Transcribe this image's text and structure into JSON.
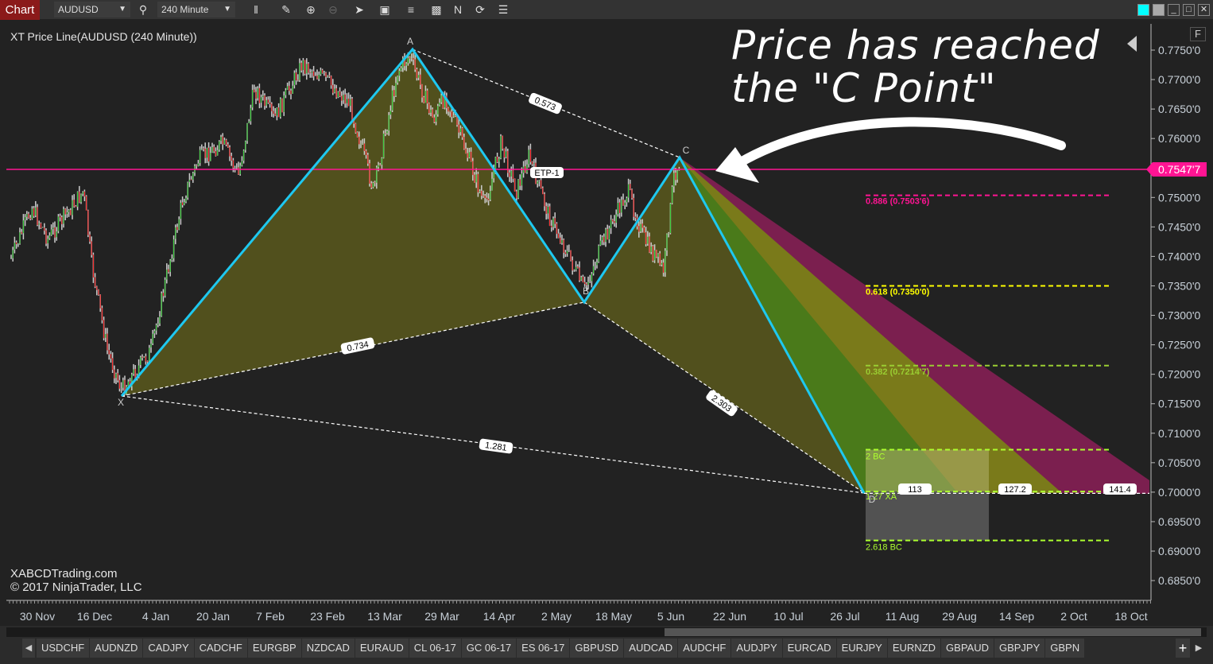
{
  "toolbar": {
    "chart_label": "Chart",
    "instrument": "AUDUSD",
    "interval": "240 Minute",
    "icons": [
      "search-icon",
      "bar-type-icon",
      "pencil-icon",
      "zoom-in-icon",
      "zoom-out-icon",
      "pointer-icon",
      "data-box-icon",
      "strategies-icon",
      "templates-icon",
      "indicators-icon",
      "refresh-icon",
      "properties-icon"
    ],
    "window_controls": [
      "link-color",
      "link-gray",
      "minimize",
      "maximize",
      "close"
    ]
  },
  "chart": {
    "indicator_title": "XT Price Line(AUDUSD (240 Minute))",
    "annotation": [
      "Price has reached",
      "the \"C Point\""
    ],
    "watermark": "XABCDTrading.com",
    "copyright": "© 2017 NinjaTrader, LLC",
    "f_button": "F",
    "current_price": "0.7547'7",
    "price_line_color": "#ff1493",
    "pattern_color": "#1ec8f0",
    "price_ticks": [
      "0.7750'0",
      "0.7700'0",
      "0.7650'0",
      "0.7600'0",
      "0.7550'0",
      "0.7500'0",
      "0.7450'0",
      "0.7400'0",
      "0.7350'0",
      "0.7300'0",
      "0.7250'0",
      "0.7200'0",
      "0.7150'0",
      "0.7100'0",
      "0.7050'0",
      "0.7000'0",
      "0.6950'0",
      "0.6900'0",
      "0.6850'0"
    ],
    "date_ticks": [
      "30 Nov",
      "16 Dec",
      "4 Jan",
      "20 Jan",
      "7 Feb",
      "23 Feb",
      "13 Mar",
      "29 Mar",
      "14 Apr",
      "2 May",
      "18 May",
      "5 Jun",
      "22 Jun",
      "10 Jul",
      "26 Jul",
      "11 Aug",
      "29 Aug",
      "14 Sep",
      "2 Oct",
      "18 Oct"
    ],
    "points": {
      "X": "X",
      "A": "A",
      "B": "B",
      "C": "C",
      "D": "D"
    },
    "ratios": {
      "xb": "0.734",
      "ac": "0.573",
      "bd": "2.303",
      "xd": "1.281"
    },
    "etp": "ETP-1",
    "fib_levels": [
      {
        "label": "0.886 (0.7503'6)",
        "price": 0.75036,
        "color": "#ff1493"
      },
      {
        "label": "0.618 (0.7350'0)",
        "price": 0.735,
        "color": "#ffff00"
      },
      {
        "label": "0.382 (0.7214'7)",
        "price": 0.72147,
        "color": "#9acd32"
      },
      {
        "label": "2 BC",
        "price": 0.7072,
        "color": "#adff2f"
      },
      {
        "label": "1.27 XA",
        "price": 0.7001,
        "color": "#adff2f"
      },
      {
        "label": "2.618 BC",
        "price": 0.6918,
        "color": "#adff2f"
      }
    ],
    "fan_labels": [
      "113",
      "127.2",
      "141.4"
    ]
  },
  "tabs": [
    "USDCHF",
    "AUDNZD",
    "CADJPY",
    "CADCHF",
    "EURGBP",
    "NZDCAD",
    "EURAUD",
    "CL 06-17",
    "GC 06-17",
    "ES 06-17",
    "GBPUSD",
    "AUDCAD",
    "AUDCHF",
    "AUDJPY",
    "EURCAD",
    "EURJPY",
    "EURNZD",
    "GBPAUD",
    "GBPJPY",
    "GBPN"
  ]
}
